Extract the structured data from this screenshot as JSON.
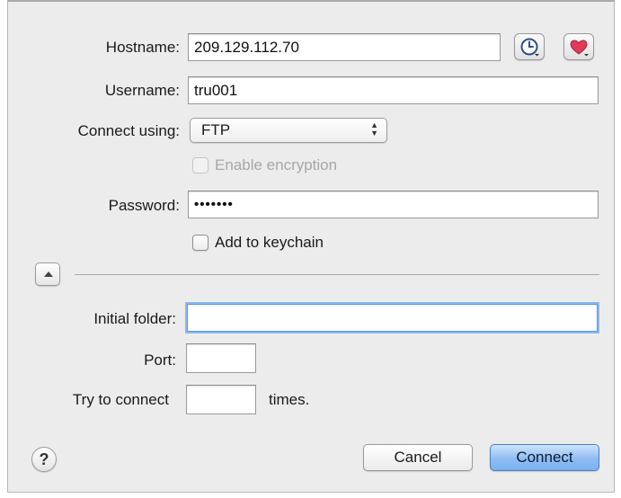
{
  "form": {
    "hostname_label": "Hostname:",
    "hostname_value": "209.129.112.70",
    "username_label": "Username:",
    "username_value": "tru001",
    "connect_label": "Connect using:",
    "connect_value": "FTP",
    "encryption_label": "Enable encryption",
    "password_label": "Password:",
    "password_value": "•••••••",
    "keychain_label": "Add to keychain",
    "initial_folder_label": "Initial folder:",
    "initial_folder_value": "",
    "port_label": "Port:",
    "port_value": "",
    "try_label": "Try to connect",
    "try_value": "",
    "times_label": "times."
  },
  "buttons": {
    "help_label": "?",
    "cancel_label": "Cancel",
    "connect_label": "Connect"
  },
  "icons": {
    "history": "clock-icon",
    "favorites": "heart-icon",
    "popup_arrows": "up-down-arrows-icon",
    "disclosure": "triangle-up-icon"
  },
  "colors": {
    "heart": "#e23b5a",
    "clock": "#2f4f8a",
    "default_button": "#8fbdf2",
    "focus_ring": "#8bb8ee"
  }
}
